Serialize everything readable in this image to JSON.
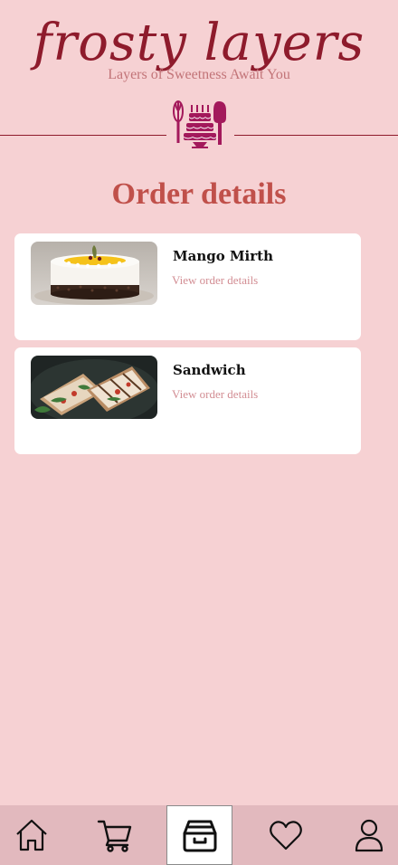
{
  "app": {
    "name": "frosty layers",
    "tagline": "Layers of Sweetness Await You"
  },
  "page": {
    "title": "Order details"
  },
  "orders": [
    {
      "name": "Mango Mirth",
      "link_label": "View order details",
      "image": "cake-photo"
    },
    {
      "name": "Sandwich",
      "link_label": "View order details",
      "image": "sandwich-photo"
    }
  ],
  "nav": {
    "items": [
      {
        "id": "home",
        "icon": "home-icon",
        "active": false
      },
      {
        "id": "cart",
        "icon": "cart-icon",
        "active": false
      },
      {
        "id": "orders",
        "icon": "orders-box-icon",
        "active": true
      },
      {
        "id": "favorites",
        "icon": "heart-icon",
        "active": false
      },
      {
        "id": "profile",
        "icon": "user-icon",
        "active": false
      }
    ]
  },
  "colors": {
    "background": "#f6d1d3",
    "brand": "#8e1b2c",
    "title": "#c0504a",
    "link": "#d28d93",
    "nav_bar": "#e2b9be",
    "emblem": "#a3195b"
  }
}
